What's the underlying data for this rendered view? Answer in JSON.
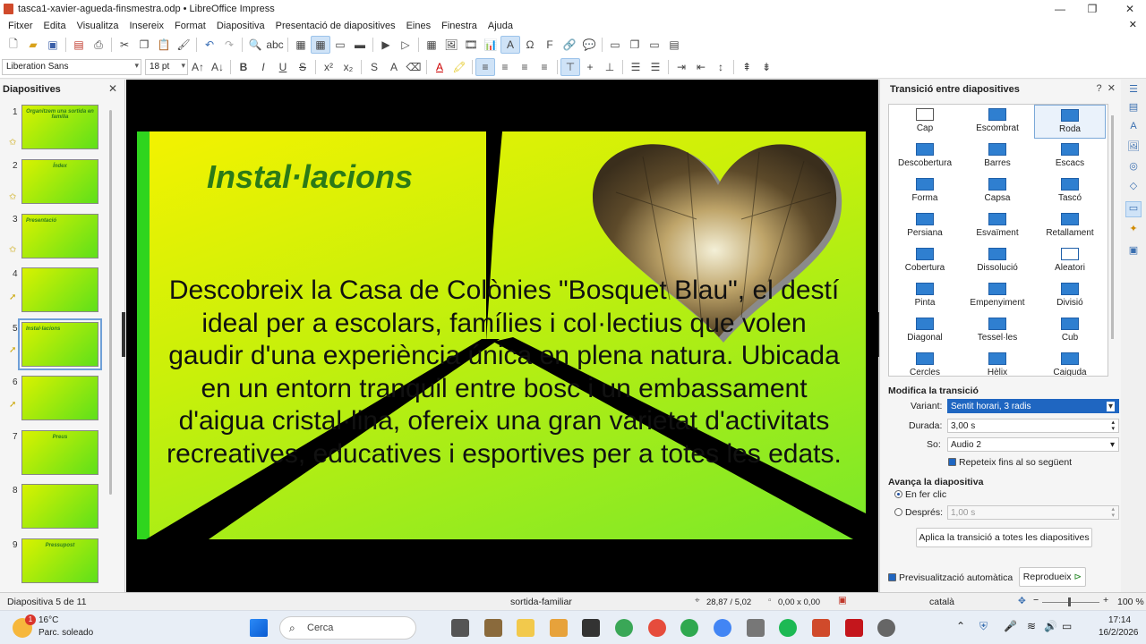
{
  "window": {
    "title": "tasca1-xavier-agueda-finsmestra.odp • LibreOffice Impress"
  },
  "menu": [
    "Fitxer",
    "Edita",
    "Visualitza",
    "Insereix",
    "Format",
    "Diapositiva",
    "Presentació de diapositives",
    "Eines",
    "Finestra",
    "Ajuda"
  ],
  "format": {
    "font_name": "Liberation Sans",
    "font_size": "18 pt"
  },
  "slides_panel": {
    "title": "Diapositives",
    "thumbs": [
      {
        "num": "1",
        "caption": "Organitzem una sortida en família"
      },
      {
        "num": "2",
        "caption": "Índex"
      },
      {
        "num": "3",
        "caption": "Presentació"
      },
      {
        "num": "4",
        "caption": ""
      },
      {
        "num": "5",
        "caption": "Instal·lacions"
      },
      {
        "num": "6",
        "caption": ""
      },
      {
        "num": "7",
        "caption": "Preus"
      },
      {
        "num": "8",
        "caption": ""
      },
      {
        "num": "9",
        "caption": "Pressupost"
      }
    ]
  },
  "slide": {
    "title": "Instal·lacions",
    "body": "Descobreix la Casa de Colònies \"Bosquet Blau\", el destí ideal per a escolars, famílies i col·lectius que volen gaudir d'una experiència única en plena natura. Ubicada en un entorn tranquil entre bosc i un embassament d'aigua cristal·lina, ofereix una gran varietat d'activitats recreatives, educatives i esportives per a totes les edats."
  },
  "transition_panel": {
    "title": "Transició entre diapositives",
    "items": [
      "Cap",
      "Escombrat",
      "Roda",
      "Descobertura",
      "Barres",
      "Escacs",
      "Forma",
      "Capsa",
      "Tascó",
      "Persiana",
      "Esvaïment",
      "Retallament",
      "Cobertura",
      "Dissolució",
      "Aleatori",
      "Pinta",
      "Empenyiment",
      "Divisió",
      "Diagonal",
      "Tessel·les",
      "Cub",
      "Cercles",
      "Hèlix",
      "Caiguda"
    ],
    "selected": "Roda",
    "modify_heading": "Modifica la transició",
    "variant_label": "Variant:",
    "variant_value": "Sentit horari, 3 radis",
    "duration_label": "Durada:",
    "duration_value": "3,00 s",
    "sound_label": "So:",
    "sound_value": "Audio 2",
    "repeat_label": "Repeteix fins al so següent",
    "advance_heading": "Avança la diapositiva",
    "on_click_label": "En fer clic",
    "after_label": "Després:",
    "after_value": "1,00 s",
    "apply_all_label": "Aplica la transició a totes les diapositives",
    "autopreview_label": "Previsualització automàtica",
    "play_label": "Reprodueix"
  },
  "status": {
    "slide_info": "Diapositiva 5 de 11",
    "master": "sortida-familiar",
    "position": "28,87 / 5,02",
    "size": "0,00 x 0,00",
    "language": "català",
    "zoom": "100 %"
  },
  "taskbar": {
    "weather_temp": "16°C",
    "weather_desc": "Parc. soleado",
    "weather_badge": "1",
    "search_placeholder": "Cerca",
    "time": "17:14",
    "date": "16/2/2026"
  }
}
